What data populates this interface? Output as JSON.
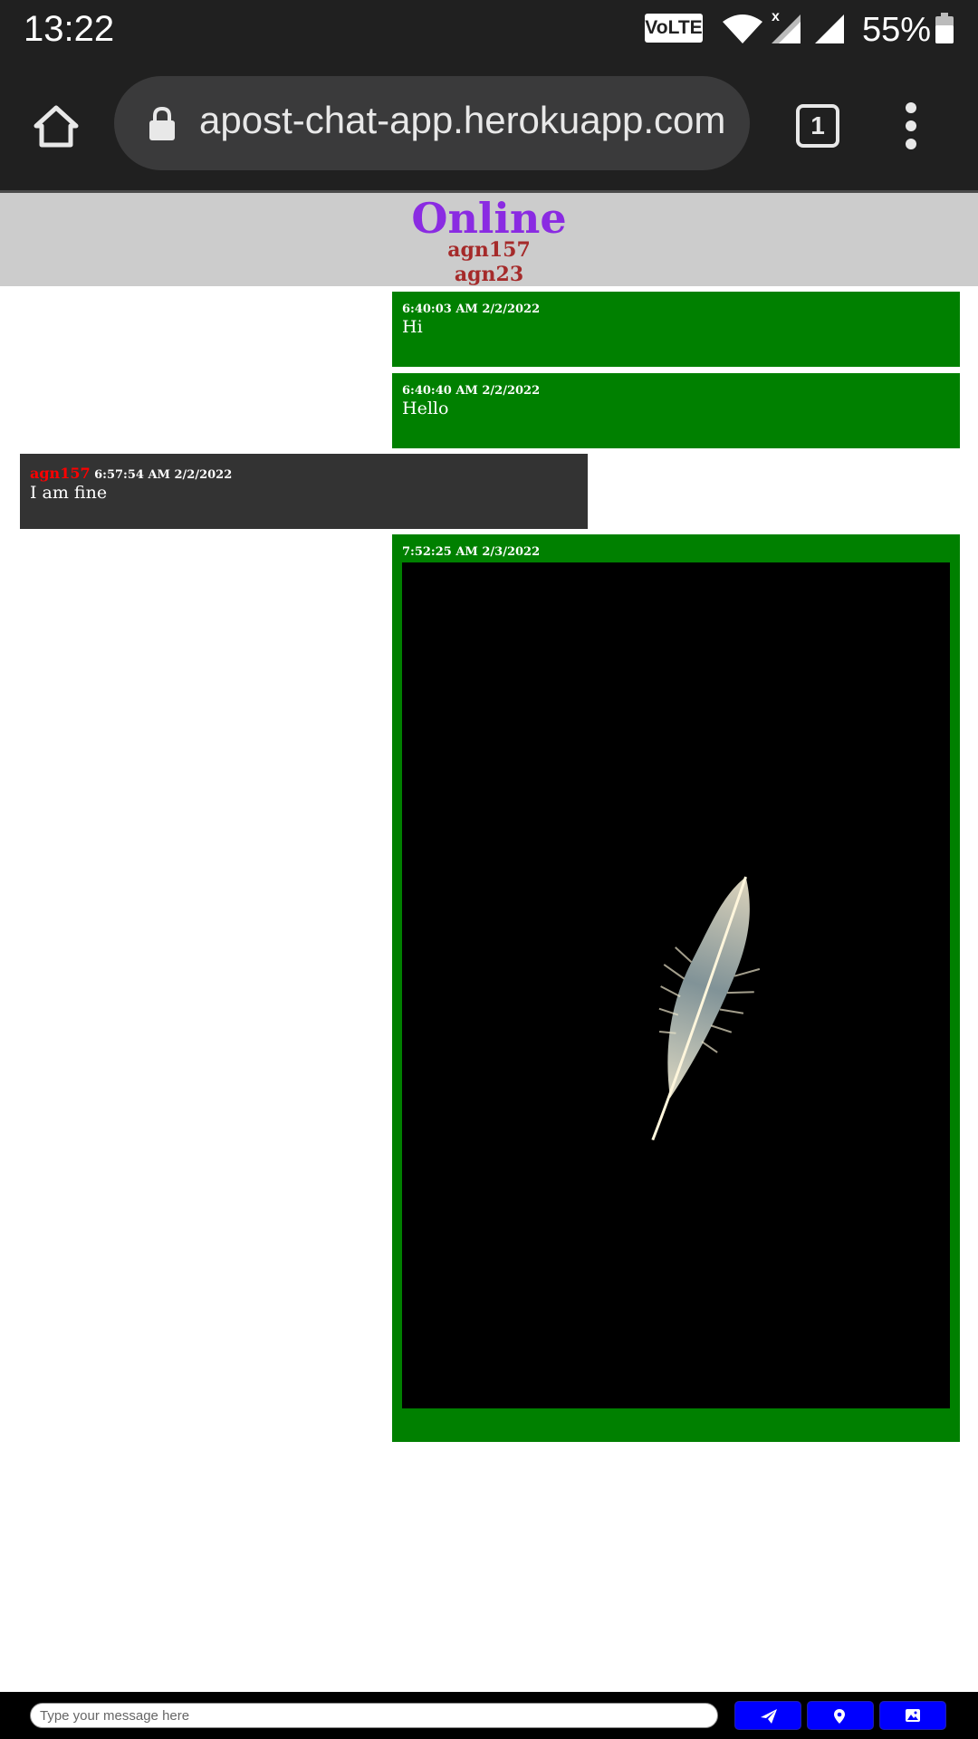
{
  "status_bar": {
    "time": "13:22",
    "volte_label": "VoLTE",
    "wifi_badge": "x",
    "battery_percent": "55%",
    "icons": [
      "wifi-icon",
      "signal-icon",
      "battery-icon"
    ]
  },
  "browser": {
    "url": "apost-chat-app.herokuapp.com",
    "tab_count": "1",
    "icons": [
      "home-icon",
      "lock-icon",
      "tabs-icon",
      "overflow-menu-icon"
    ]
  },
  "online": {
    "title": "Online",
    "users": [
      "agn157",
      "agn23"
    ]
  },
  "messages": [
    {
      "from_self": true,
      "timestamp": "6:40:03 AM 2/2/2022",
      "text": "Hi"
    },
    {
      "from_self": true,
      "timestamp": "6:40:40 AM 2/2/2022",
      "text": "Hello"
    },
    {
      "from_self": false,
      "sender": "agn157",
      "timestamp": "6:57:54 AM 2/2/2022",
      "text": "I am fine"
    },
    {
      "from_self": true,
      "timestamp": "7:52:25 AM 2/3/2022",
      "image": "feather-image"
    }
  ],
  "composer": {
    "placeholder": "Type your message here",
    "buttons": [
      "send-icon",
      "location-pin-icon",
      "image-icon"
    ]
  },
  "colors": {
    "own_message": "#008000",
    "other_message": "#333333",
    "online_title": "#8a2be2",
    "online_user": "#a52a2a",
    "sender_name": "#ff0000",
    "button": "#0000ff"
  }
}
